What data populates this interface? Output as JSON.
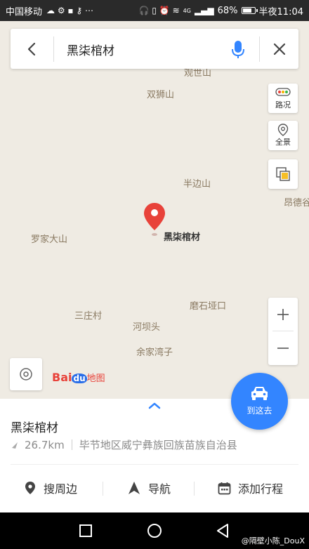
{
  "status_bar": {
    "carrier": "中国移动",
    "network": "4G",
    "battery": "68%",
    "battery_level": 0.68,
    "time": "半夜11:04"
  },
  "search": {
    "query": "黑柒棺材"
  },
  "map": {
    "places": [
      {
        "id": "guanshishan",
        "label": "观世山"
      },
      {
        "id": "shuangshishan",
        "label": "双狮山"
      },
      {
        "id": "banbianshan",
        "label": "半边山"
      },
      {
        "id": "angdegu",
        "label": "昂德谷"
      },
      {
        "id": "luojiadashan",
        "label": "罗家大山"
      },
      {
        "id": "moshiyakou",
        "label": "磨石垭口"
      },
      {
        "id": "sanzhuangcun",
        "label": "三庄村"
      },
      {
        "id": "hebatou",
        "label": "河坝头"
      },
      {
        "id": "yujiawanzi",
        "label": "余家湾子"
      }
    ],
    "marker_label": "黑柒棺材",
    "logo_text_1": "Bai",
    "logo_text_2": "du",
    "logo_text_3": "地图"
  },
  "controls": {
    "traffic_label": "路况",
    "panorama_label": "全景",
    "zoom_in": "+",
    "zoom_out": "—"
  },
  "goto_button": {
    "label": "到这去"
  },
  "place_panel": {
    "name": "黑柒棺材",
    "distance": "26.7km",
    "address": "毕节地区威宁彝族回族苗族自治县",
    "actions": {
      "nearby": "搜周边",
      "navigate": "导航",
      "add_trip": "添加行程"
    }
  },
  "watermark": "@隔壁小陈_DouX",
  "colors": {
    "accent": "#3385ff",
    "marker": "#e8423a",
    "map_bg": "#efebe3"
  }
}
